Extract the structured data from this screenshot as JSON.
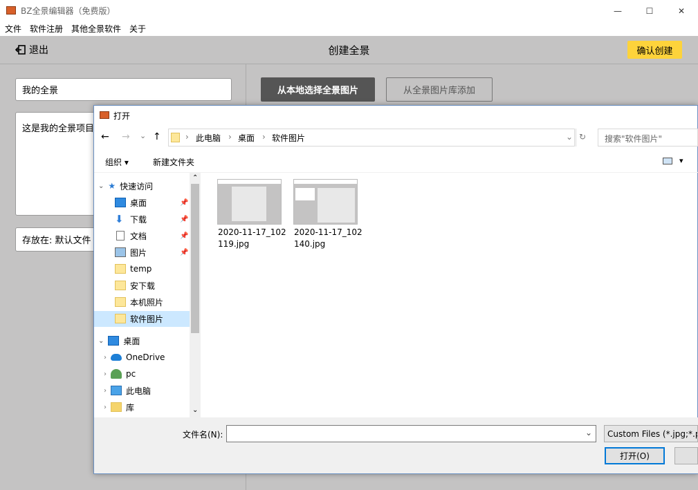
{
  "window": {
    "title": "BZ全景编辑器（免费版）",
    "minimize": "—",
    "maximize": "☐",
    "close": "✕"
  },
  "menu": {
    "items": [
      "文件",
      "软件注册",
      "其他全景软件",
      "关于"
    ]
  },
  "header": {
    "exit_label": "退出",
    "title": "创建全景",
    "confirm_label": "确认创建"
  },
  "form": {
    "name_value": "我的全景",
    "desc_value": "这是我的全景项目",
    "store_value": "存放在: 默认文件"
  },
  "actions": {
    "local_label": "从本地选择全景图片",
    "library_label": "从全景图片库添加"
  },
  "dialog": {
    "title": "打开",
    "nav_back": "←",
    "nav_forward": "→",
    "nav_down": "⌄",
    "nav_up": "↑",
    "breadcrumb": [
      "此电脑",
      "桌面",
      "软件图片"
    ],
    "refresh": "↻",
    "search_placeholder": "搜索\"软件图片\"",
    "toolbar": {
      "organize": "组织 ▾",
      "new_folder": "新建文件夹",
      "view_toggle": "▾"
    },
    "nav": {
      "quick_access": "快速访问",
      "quick_items": [
        "桌面",
        "下载",
        "文档",
        "图片",
        "temp",
        "安下载",
        "本机照片",
        "软件图片"
      ],
      "desktop": "桌面",
      "desktop_items": [
        "OneDrive",
        "pc",
        "此电脑",
        "库"
      ]
    },
    "files": [
      {
        "name_line1": "2020-11-17_102",
        "name_line2": "119.jpg"
      },
      {
        "name_line1": "2020-11-17_102",
        "name_line2": "140.jpg"
      }
    ],
    "filename_label": "文件名(N):",
    "filename_value": "",
    "filter_value": "Custom Files (*.jpg;*.pj",
    "open_label": "打开(O)"
  },
  "colors": {
    "accent": "#fdd33b",
    "app_bg": "#c4c3c3",
    "selection": "#cce8ff",
    "dialog_border": "#6a8fc2"
  }
}
